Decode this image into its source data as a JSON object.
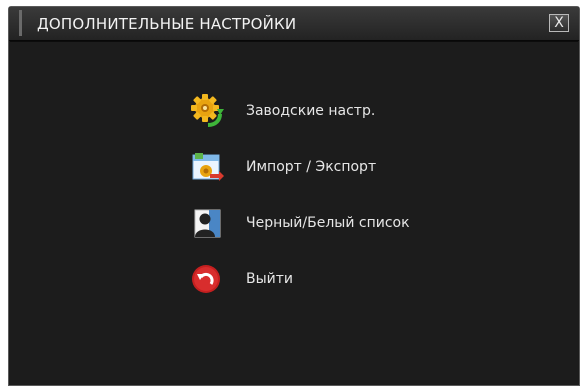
{
  "window": {
    "title": "ДОПОЛНИТЕЛЬНЫЕ НАСТРОЙКИ",
    "close_label": "X"
  },
  "menu": {
    "items": [
      {
        "label": "Заводские настр.",
        "icon": "gear-reset-icon"
      },
      {
        "label": "Импорт / Экспорт",
        "icon": "import-export-icon"
      },
      {
        "label": "Черный/Белый список",
        "icon": "user-list-icon"
      },
      {
        "label": "Выйти",
        "icon": "exit-icon"
      }
    ]
  },
  "colors": {
    "background": "#1c1c1c",
    "title_bar": "#2e2e2e",
    "text": "#e6e6e6"
  }
}
